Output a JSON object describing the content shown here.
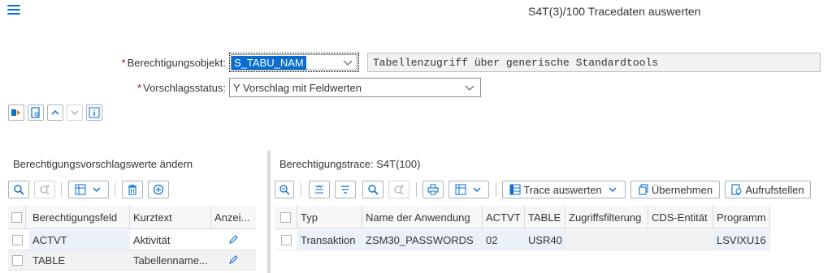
{
  "header": {
    "title": "S4T(3)/100 Tracedaten auswerten"
  },
  "form": {
    "auth_object_label": "Berechtigungsobjekt:",
    "auth_object_value": "S_TABU_NAM",
    "auth_object_description": "Tabellenzugriff über generische Standardtools",
    "proposal_status_label": "Vorschlagsstatus:",
    "proposal_status_value": "Y Vorschlag mit Feldwerten",
    "required_marker": "*"
  },
  "left_panel": {
    "title": "Berechtigungsvorschlagswerte ändern",
    "columns": [
      "Berechtigungsfeld",
      "Kurztext",
      "Anzei..."
    ],
    "rows": [
      {
        "field": "ACTVT",
        "text": "Aktivität"
      },
      {
        "field": "TABLE",
        "text": "Tabellenname..."
      }
    ]
  },
  "right_panel": {
    "title": "Berechtigungstrace: S4T(100)",
    "toolbar": {
      "evaluate_label": "Trace auswerten",
      "apply_label": "Übernehmen",
      "setup_label": "Aufrufstellen"
    },
    "columns": [
      "Typ",
      "Name der Anwendung",
      "ACTVT",
      "TABLE",
      "Zugriffsfilterung",
      "CDS-Entität",
      "Programm"
    ],
    "rows": [
      {
        "typ": "Transaktion",
        "name": "ZSM30_PASSWORDS",
        "actvt": "02",
        "table": "USR40",
        "filter": "",
        "cds": "",
        "program": "LSVIXU16"
      }
    ]
  },
  "colors": {
    "accent": "#0a6ed1",
    "required": "#bb0000"
  }
}
